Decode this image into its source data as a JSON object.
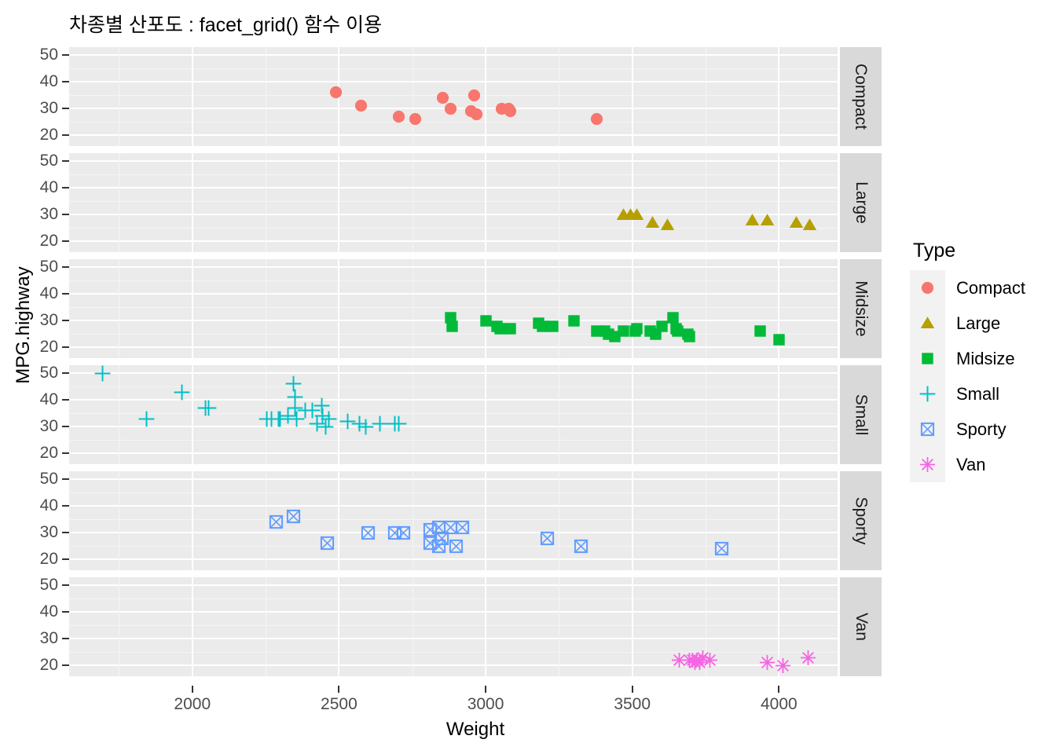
{
  "title": "차종별 산포도 : facet_grid() 함수 이용",
  "axes": {
    "x_label": "Weight",
    "y_label": "MPG.highway",
    "x_ticks": [
      2000,
      2500,
      3000,
      3500,
      4000
    ],
    "y_ticks": [
      20,
      30,
      40,
      50
    ],
    "x_range": [
      1580,
      4200
    ],
    "y_range": [
      16,
      53
    ]
  },
  "legend": {
    "title": "Type",
    "items": [
      {
        "label": "Compact",
        "color": "#F8766D",
        "shape": "circle"
      },
      {
        "label": "Large",
        "color": "#B79F00",
        "shape": "triangle"
      },
      {
        "label": "Midsize",
        "color": "#00BA38",
        "shape": "square"
      },
      {
        "label": "Small",
        "color": "#00BFC4",
        "shape": "plus"
      },
      {
        "label": "Sporty",
        "color": "#619CFF",
        "shape": "square-cross"
      },
      {
        "label": "Van",
        "color": "#F564E3",
        "shape": "asterisk"
      }
    ]
  },
  "chart_data": {
    "type": "scatter",
    "title": "차종별 산포도 : facet_grid() 함수 이용",
    "xlabel": "Weight",
    "ylabel": "MPG.highway",
    "xlim": [
      1580,
      4200
    ],
    "ylim": [
      16,
      53
    ],
    "xticks": [
      2000,
      2500,
      3000,
      3500,
      4000
    ],
    "yticks": [
      20,
      30,
      40,
      50
    ],
    "grid": true,
    "legend_position": "right",
    "legend_title": "Type",
    "facet": "facet_grid(Type ~ .)",
    "series": [
      {
        "name": "Compact",
        "color": "#F8766D",
        "shape": "circle",
        "points": [
          [
            2490,
            36
          ],
          [
            2575,
            31
          ],
          [
            2705,
            27
          ],
          [
            2760,
            26
          ],
          [
            2855,
            34
          ],
          [
            2880,
            30
          ],
          [
            2950,
            29
          ],
          [
            2960,
            35
          ],
          [
            2970,
            28
          ],
          [
            3055,
            30
          ],
          [
            3085,
            29
          ],
          [
            3080,
            30
          ],
          [
            3380,
            26
          ]
        ]
      },
      {
        "name": "Large",
        "color": "#B79F00",
        "shape": "triangle",
        "points": [
          [
            3470,
            30
          ],
          [
            3495,
            30
          ],
          [
            3515,
            30
          ],
          [
            3570,
            27
          ],
          [
            3620,
            26
          ],
          [
            3910,
            28
          ],
          [
            3960,
            28
          ],
          [
            4060,
            27
          ],
          [
            4105,
            26
          ]
        ]
      },
      {
        "name": "Midsize",
        "color": "#00BA38",
        "shape": "square",
        "points": [
          [
            2880,
            31
          ],
          [
            2885,
            28
          ],
          [
            3000,
            30
          ],
          [
            3040,
            28
          ],
          [
            3050,
            27
          ],
          [
            3085,
            27
          ],
          [
            3180,
            29
          ],
          [
            3195,
            28
          ],
          [
            3230,
            28
          ],
          [
            3300,
            30
          ],
          [
            3380,
            26
          ],
          [
            3405,
            26
          ],
          [
            3420,
            25
          ],
          [
            3440,
            24
          ],
          [
            3470,
            26
          ],
          [
            3510,
            26
          ],
          [
            3515,
            27
          ],
          [
            3560,
            26
          ],
          [
            3580,
            25
          ],
          [
            3600,
            28
          ],
          [
            3640,
            31
          ],
          [
            3650,
            27
          ],
          [
            3655,
            26
          ],
          [
            3690,
            25
          ],
          [
            3695,
            24
          ],
          [
            3935,
            26
          ],
          [
            4000,
            23
          ]
        ]
      },
      {
        "name": "Small",
        "color": "#00BFC4",
        "shape": "plus",
        "points": [
          [
            1695,
            50
          ],
          [
            1845,
            33
          ],
          [
            1965,
            43
          ],
          [
            2045,
            37
          ],
          [
            2055,
            37
          ],
          [
            2255,
            33
          ],
          [
            2270,
            33
          ],
          [
            2295,
            33
          ],
          [
            2300,
            33
          ],
          [
            2325,
            34
          ],
          [
            2345,
            46
          ],
          [
            2350,
            41
          ],
          [
            2350,
            37
          ],
          [
            2355,
            33
          ],
          [
            2385,
            36
          ],
          [
            2410,
            36
          ],
          [
            2425,
            31
          ],
          [
            2440,
            38
          ],
          [
            2445,
            34
          ],
          [
            2455,
            30
          ],
          [
            2465,
            33
          ],
          [
            2530,
            32
          ],
          [
            2570,
            31
          ],
          [
            2590,
            30
          ],
          [
            2640,
            31
          ],
          [
            2690,
            31
          ],
          [
            2705,
            31
          ]
        ]
      },
      {
        "name": "Sporty",
        "color": "#619CFF",
        "shape": "square-cross",
        "points": [
          [
            2285,
            34
          ],
          [
            2345,
            36
          ],
          [
            2460,
            26
          ],
          [
            2600,
            30
          ],
          [
            2690,
            30
          ],
          [
            2720,
            30
          ],
          [
            2810,
            31
          ],
          [
            2810,
            26
          ],
          [
            2840,
            32
          ],
          [
            2840,
            25
          ],
          [
            2850,
            28
          ],
          [
            2880,
            32
          ],
          [
            2900,
            25
          ],
          [
            2920,
            32
          ],
          [
            3210,
            28
          ],
          [
            3325,
            25
          ],
          [
            3805,
            24
          ]
        ]
      },
      {
        "name": "Van",
        "color": "#F564E3",
        "shape": "asterisk",
        "points": [
          [
            3660,
            22
          ],
          [
            3695,
            22
          ],
          [
            3705,
            22
          ],
          [
            3715,
            21
          ],
          [
            3720,
            22
          ],
          [
            3730,
            21
          ],
          [
            3740,
            23
          ],
          [
            3765,
            22
          ],
          [
            3960,
            21
          ],
          [
            4015,
            20
          ],
          [
            4100,
            23
          ]
        ]
      }
    ]
  },
  "facets": [
    {
      "label": "Compact",
      "series": "Compact"
    },
    {
      "label": "Large",
      "series": "Large"
    },
    {
      "label": "Midsize",
      "series": "Midsize"
    },
    {
      "label": "Small",
      "series": "Small"
    },
    {
      "label": "Sporty",
      "series": "Sporty"
    },
    {
      "label": "Van",
      "series": "Van"
    }
  ]
}
